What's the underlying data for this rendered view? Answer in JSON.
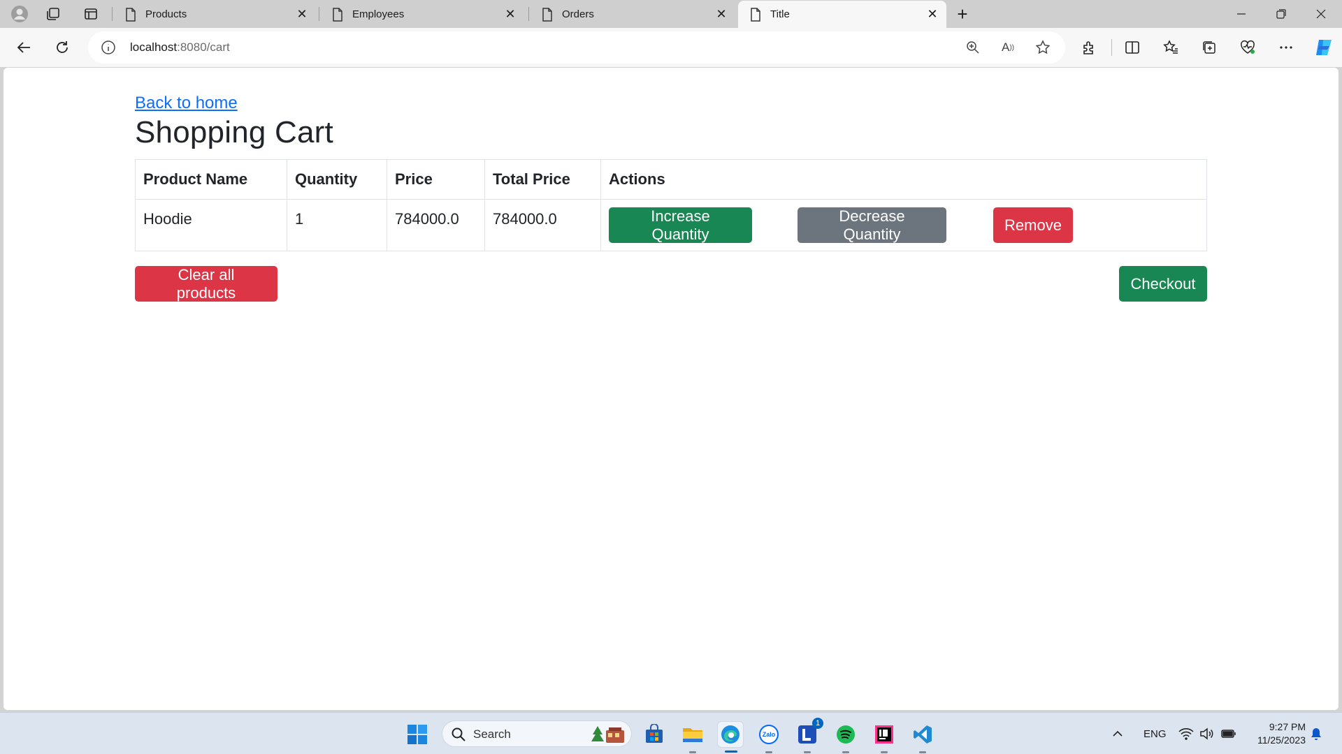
{
  "browser": {
    "tabs": [
      {
        "label": "Products"
      },
      {
        "label": "Employees"
      },
      {
        "label": "Orders"
      },
      {
        "label": "Title"
      }
    ],
    "address": {
      "host": "localhost",
      "path": ":8080/cart"
    }
  },
  "page": {
    "back_link": "Back to home",
    "title": "Shopping Cart",
    "table": {
      "headers": [
        "Product Name",
        "Quantity",
        "Price",
        "Total Price",
        "Actions"
      ],
      "rows": [
        {
          "name": "Hoodie",
          "quantity": "1",
          "price": "784000.0",
          "total": "784000.0"
        }
      ]
    },
    "buttons": {
      "increase": "Increase Quantity",
      "decrease": "Decrease Quantity",
      "remove": "Remove",
      "clear_all": "Clear all products",
      "checkout": "Checkout"
    },
    "colors": {
      "success": "#198754",
      "secondary": "#6c757d",
      "danger": "#dc3545",
      "link": "#0d6efd"
    }
  },
  "taskbar": {
    "search_label": "Search",
    "apps": [
      "store-icon",
      "file-explorer-icon",
      "edge-icon",
      "zalo-icon",
      "l-app-icon",
      "spotify-icon",
      "intellij-icon",
      "vscode-icon"
    ],
    "zalo_text": "Zalo",
    "l_badge": "1",
    "language": "ENG",
    "time": "9:27 PM",
    "date": "11/25/2023"
  }
}
